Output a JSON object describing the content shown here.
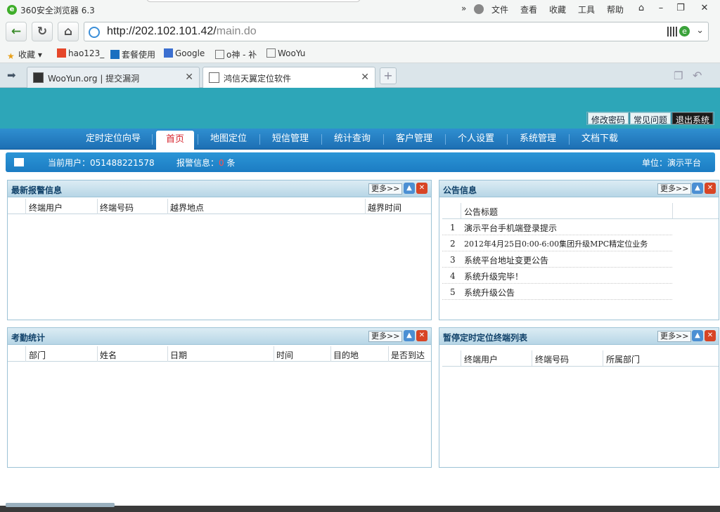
{
  "browser": {
    "title": "360安全浏览器 6.3",
    "menu": [
      "文件",
      "查看",
      "收藏",
      "工具",
      "帮助"
    ],
    "url_host": "http://202.102.101.42/",
    "url_path": "main.do",
    "bookmarks": [
      "收藏",
      "hao123_",
      "套餐使用",
      "Google",
      "o神 - 补",
      "WooYu"
    ],
    "tabs": [
      {
        "label": "WooYun.org | 提交漏洞"
      },
      {
        "label": "鸿信天翼定位软件"
      }
    ]
  },
  "page": {
    "top_buttons": [
      "修改密码",
      "常见问题",
      "退出系统"
    ],
    "nav": [
      "定时定位向导",
      "首页",
      "地图定位",
      "短信管理",
      "统计查询",
      "客户管理",
      "个人设置",
      "系统管理",
      "文档下载"
    ],
    "info": {
      "user_label": "当前用户：",
      "user": "051488221578",
      "alarm_label": "报警信息：",
      "alarm_count": "0",
      "alarm_unit": "条",
      "unit_label": "单位：",
      "unit": "演示平台"
    },
    "more": "更多>>",
    "panels": {
      "alarm": {
        "title": "最新报警信息",
        "cols": [
          "终端用户",
          "终端号码",
          "越界地点",
          "越界时间"
        ]
      },
      "notice": {
        "title": "公告信息",
        "col": "公告标题",
        "items": [
          {
            "n": "1",
            "t": "演示平台手机端登录提示"
          },
          {
            "n": "2",
            "t": "2012年4月25日0:00-6:00集团升级MPC精定位业务"
          },
          {
            "n": "3",
            "t": "系统平台地址变更公告"
          },
          {
            "n": "4",
            "t": "系统升级完毕！"
          },
          {
            "n": "5",
            "t": "系统升级公告"
          }
        ]
      },
      "attendance": {
        "title": "考勤统计",
        "cols": [
          "部门",
          "姓名",
          "日期",
          "时间",
          "目的地",
          "是否到达"
        ]
      },
      "paused": {
        "title": "暂停定时定位终端列表",
        "cols": [
          "终端用户",
          "终端号码",
          "所属部门"
        ]
      }
    }
  }
}
